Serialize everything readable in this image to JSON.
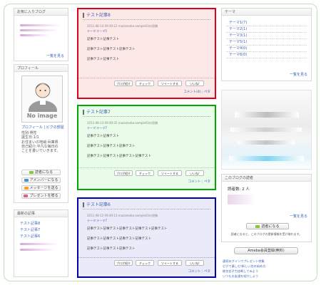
{
  "left": {
    "favorites": {
      "title": "お気に入りブログ",
      "more": "一覧を見る"
    },
    "profile": {
      "title": "プロフィール",
      "noimage": "No image",
      "links": "プロフィール | ピグの部屋",
      "lines": [
        "性別:男性",
        "誕生日:1/1",
        "お住まいの地域:兵庫県",
        "自己紹介:平凡な毎日の",
        "ことを書いていきます。"
      ]
    },
    "buttons": {
      "reader": "読者になる",
      "amember": "アメンバーになる",
      "message": "メッセージを送る",
      "present": "プレゼントを贈る"
    },
    "recent": {
      "title": "最新の記事",
      "items": [
        "テスト記事8",
        "テスト記事7",
        "テスト記事6"
      ]
    }
  },
  "entries": [
    {
      "title": "テスト記事8",
      "date": "2011-08-14 09:49:22",
      "by": "mazameba-sample03の投稿",
      "theme": "テーマ:テーマ5",
      "lines": [
        "記事テスト記事テスト",
        "記事テスト記事テスト記事テスト",
        "記事テスト記事テスト"
      ],
      "share": [
        "ブログ紹介",
        "チェック",
        "ツイートする",
        "いいね!"
      ],
      "comment": "コメント(4)",
      "sep": "|",
      "top": "ペタ"
    },
    {
      "title": "テスト記事7",
      "date": "2011-08-13 09:49:35",
      "by": "mazameba-sample03の投稿",
      "theme": "テーマ:テーマ7",
      "lines": [
        "記事テスト記事テスト",
        "記事テスト記事テスト記事テスト",
        "記事テスト記事テスト記事テスト記事テスト"
      ],
      "share": [
        "ブログ紹介",
        "チェック",
        "ツイートする",
        "いいね!"
      ],
      "comment": "コメント",
      "sep": "|",
      "top": "ペタ"
    },
    {
      "title": "テスト記事6",
      "date": "2011-08-12 09:49:13",
      "by": "mazameba-sample03の投稿",
      "theme": "テーマ:テーマ7",
      "lines": [
        "記事テスト記事テスト記事テスト記事テスト記事テスト",
        "記事テスト記事テスト記事テスト記事テスト",
        "記事テスト記事テスト記事テスト"
      ],
      "share": [
        "ブログ紹介",
        "チェック",
        "ツイートする",
        "いいね!"
      ],
      "comment": "コメント",
      "sep": "|",
      "top": "ペタ"
    }
  ],
  "right": {
    "theme": {
      "title": "テーマ",
      "items": [
        "テーマ1(7)",
        "テーマ2(1)",
        "テーマ3(1)",
        "テーマ5(1)",
        "テーマ4(0)",
        "テーマ6(0)"
      ],
      "more": "一覧を見る"
    },
    "readers": {
      "title": "このブログの読者",
      "count_label": "読者数:",
      "count": "2",
      "unit": "人",
      "more": "一覧を見る",
      "reader_btn": "読者になる",
      "note": "読者になると、このブログの更新情報を受け取れます。"
    },
    "register": "Ameba会員登録(無料)",
    "links": [
      "連続ログインでプレゼント特集",
      "ピグで楽しむ!新しい恋の始め方",
      "総合女子力診断してみよう",
      "いつもお友達を紹介しよう"
    ]
  },
  "colors": {
    "entry1": "#e0001b",
    "entry2": "#00a800",
    "entry3": "#0000a8"
  }
}
